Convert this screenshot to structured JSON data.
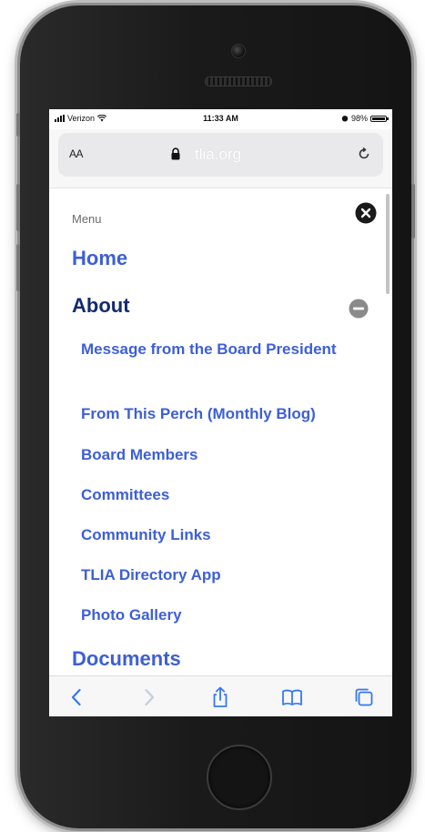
{
  "status_bar": {
    "carrier": "Verizon",
    "time": "11:33 AM",
    "battery": "98%",
    "battery_level": 0.98
  },
  "address_bar": {
    "text_size_label": "AA",
    "url": "tlia.org"
  },
  "menu": {
    "caption": "Menu",
    "home_label": "Home",
    "about_label": "About",
    "about_items": [
      {
        "label": "Message from the Board President"
      },
      {
        "label": "From This Perch (Monthly Blog)"
      },
      {
        "label": "Board Members"
      },
      {
        "label": "Committees"
      },
      {
        "label": "Community Links"
      },
      {
        "label": "TLIA Directory App"
      },
      {
        "label": "Photo Gallery"
      }
    ],
    "documents_label": "Documents"
  },
  "colors": {
    "link_blue": "#3d5fd6",
    "active_navy": "#142a73",
    "toolbar_blue": "#3478f6"
  },
  "icons": {
    "close": "close-icon",
    "collapse": "minus-circle-icon",
    "back": "chevron-left-icon",
    "forward": "chevron-right-icon",
    "share": "share-icon",
    "bookmarks": "book-icon",
    "tabs": "tabs-icon",
    "lock": "lock-icon",
    "reload": "reload-icon"
  }
}
